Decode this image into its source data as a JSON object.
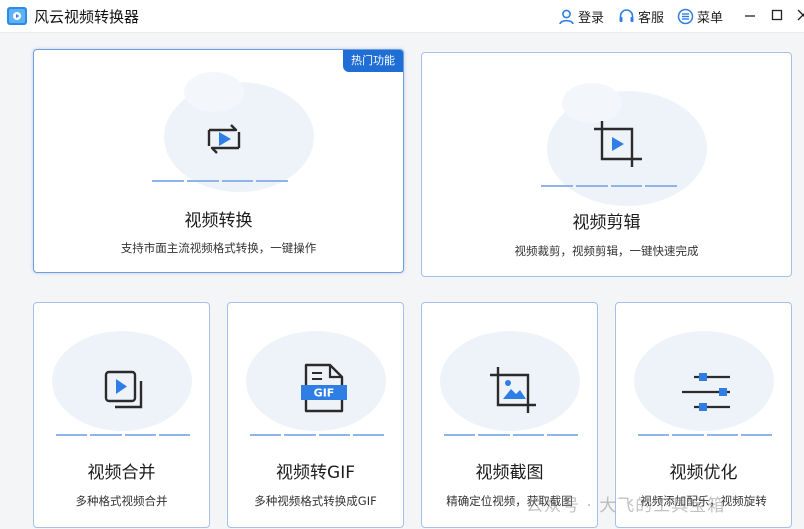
{
  "app": {
    "title": "风云视频转换器"
  },
  "titlebar": {
    "login": "登录",
    "service": "客服",
    "menu": "菜单"
  },
  "cards": [
    {
      "title": "视频转换",
      "desc": "支持市面主流视频格式转换，一键操作",
      "badge": "热门功能",
      "icon": "convert-icon"
    },
    {
      "title": "视频剪辑",
      "desc": "视频裁剪，视频剪辑，一键快速完成",
      "icon": "crop-play-icon"
    },
    {
      "title": "视频合并",
      "desc": "多种格式视频合并",
      "icon": "merge-icon"
    },
    {
      "title": "视频转GIF",
      "desc": "多种视频格式转换成GIF",
      "icon": "gif-icon",
      "gif_label": "GIF"
    },
    {
      "title": "视频截图",
      "desc": "精确定位视频，获取截图",
      "icon": "crop-image-icon"
    },
    {
      "title": "视频优化",
      "desc": "视频添加配乐，视频旋转",
      "icon": "sliders-icon"
    }
  ],
  "watermark": "公众号 · 大飞的工具宝箱",
  "colors": {
    "accent": "#1f6ed6",
    "icon_dark": "#2b2b2b",
    "icon_blue": "#2f7ee6",
    "border": "#a6c1e6"
  }
}
